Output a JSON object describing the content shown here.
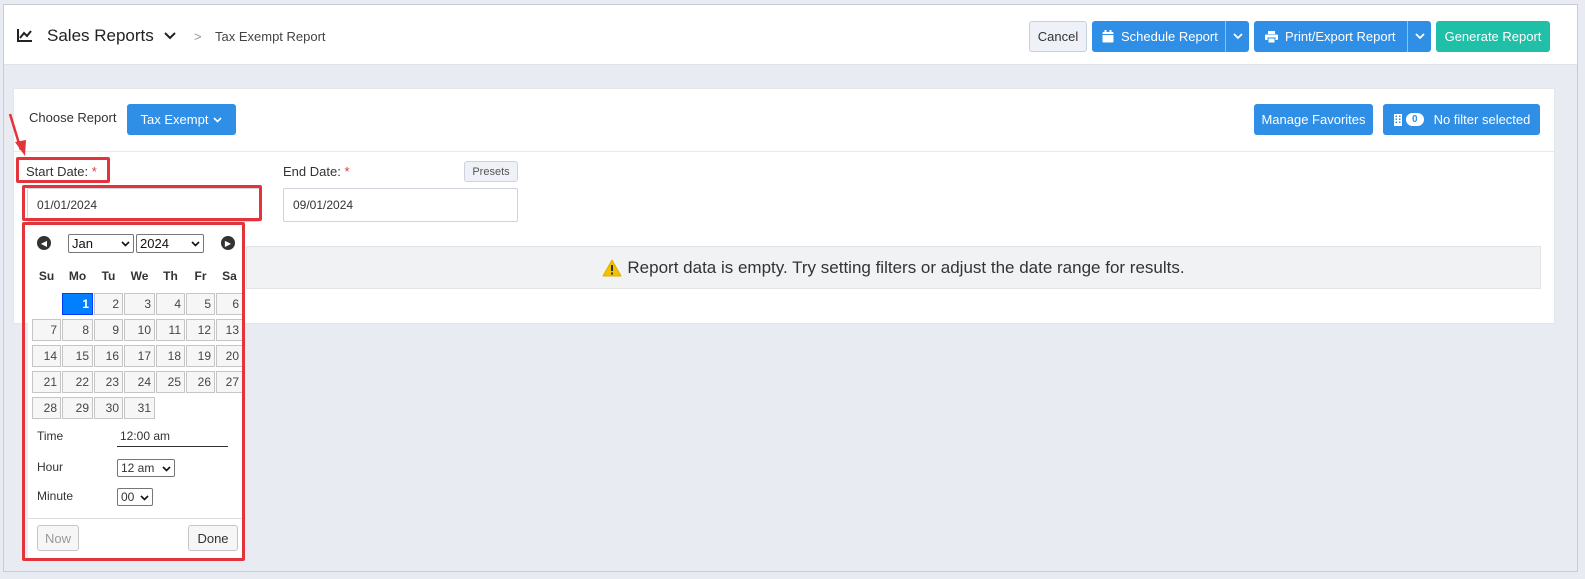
{
  "header": {
    "title": "Sales Reports",
    "breadcrumb_sep": ">",
    "breadcrumb": "Tax Exempt Report",
    "cancel_label": "Cancel",
    "schedule_label": "Schedule Report",
    "print_label": "Print/Export Report",
    "generate_label": "Generate Report",
    "icons": [
      "chart-line-icon",
      "chevron-down-icon",
      "calendar-icon",
      "printer-icon"
    ]
  },
  "toolbar": {
    "choose_label": "Choose Report",
    "report_value": "Tax Exempt",
    "manage_label": "Manage Favorites",
    "filter_count": "0",
    "filter_label": "No filter selected"
  },
  "form": {
    "start_label": "Start Date:",
    "start_value": "01/01/2024",
    "end_label": "End Date:",
    "end_value": "09/01/2024",
    "required_mark": "*",
    "presets_label": "Presets"
  },
  "message": {
    "empty": "Report data is empty. Try setting filters or adjust the date range for results."
  },
  "datepicker": {
    "month": "Jan",
    "year": "2024",
    "weekdays": [
      "Su",
      "Mo",
      "Tu",
      "We",
      "Th",
      "Fr",
      "Sa"
    ],
    "first_weekday_index": 1,
    "days": [
      "1",
      "2",
      "3",
      "4",
      "5",
      "6",
      "7",
      "8",
      "9",
      "10",
      "11",
      "12",
      "13",
      "14",
      "15",
      "16",
      "17",
      "18",
      "19",
      "20",
      "21",
      "22",
      "23",
      "24",
      "25",
      "26",
      "27",
      "28",
      "29",
      "30",
      "31"
    ],
    "selected_day": "1",
    "time_label": "Time",
    "time_value": "12:00 am",
    "hour_label": "Hour",
    "hour_value": "12 am",
    "minute_label": "Minute",
    "minute_value": "00",
    "now_label": "Now",
    "done_label": "Done"
  },
  "colors": {
    "primary": "#2f8ee6",
    "teal": "#1fbfa8",
    "annotation": "#e3333b",
    "selected_day": "#007fff"
  }
}
